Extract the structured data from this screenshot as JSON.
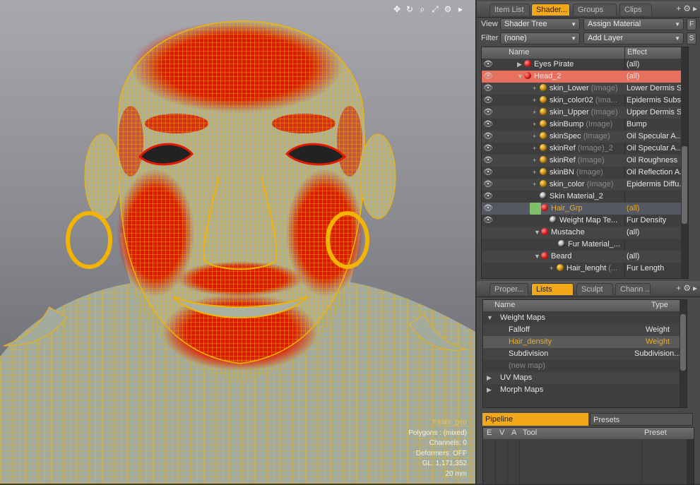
{
  "viewport": {
    "toolbar_icons": [
      "move-icon",
      "rotate-icon",
      "zoom-icon",
      "fit-icon",
      "settings-icon",
      "expand-icon"
    ],
    "info": {
      "mesh": "Pirate_geo",
      "polygons": "Polygons : (mixed)",
      "channels": "Channels: 0",
      "deformers": "Deformers: OFF",
      "gl": "GL: 1,171,352",
      "units": "20 mm"
    }
  },
  "top_tabs": [
    "Item List",
    "Shader...",
    "Groups",
    "Clips"
  ],
  "top_tabs_active": 1,
  "shader_controls": {
    "view_label": "View",
    "view_value": "Shader Tree",
    "assign_material": "Assign Material",
    "filter_label": "Filter",
    "filter_value": "(none)",
    "add_layer": "Add Layer",
    "f_button": "F",
    "s_button": "S"
  },
  "shader_tree": {
    "col_name": "Name",
    "col_effect": "Effect",
    "rows": [
      {
        "name": "Eyes Pirate",
        "sub": "",
        "effect": "(all)"
      },
      {
        "name": "Head_2",
        "sub": "",
        "effect": "(all)"
      },
      {
        "name": "skin_Lower",
        "sub": "(Image)",
        "effect": "Lower Dermis S..."
      },
      {
        "name": "skin_color02",
        "sub": "(Ima...",
        "effect": "Epidermis Subs..."
      },
      {
        "name": "skin_Upper",
        "sub": "(Image)",
        "effect": "Upper Dermis S..."
      },
      {
        "name": "skinBump",
        "sub": "(Image)",
        "effect": "Bump"
      },
      {
        "name": "skinSpec",
        "sub": "(Image)",
        "effect": "Oil Specular A..."
      },
      {
        "name": "skinRef",
        "sub": "(Image)_2",
        "effect": "Oil Specular A..."
      },
      {
        "name": "skinRef",
        "sub": "(Image)",
        "effect": "Oil Roughness"
      },
      {
        "name": "skinBN",
        "sub": "(Image)",
        "effect": "Oil Reflection A..."
      },
      {
        "name": "skin_color",
        "sub": "(Image)",
        "effect": "Epidermis Diffu..."
      },
      {
        "name": "Skin Material_2",
        "sub": "",
        "effect": ""
      },
      {
        "name": "Hair_Grp",
        "sub": "",
        "effect": "(all)"
      },
      {
        "name": "Weight Map Te...",
        "sub": "",
        "effect": "Fur Density"
      },
      {
        "name": "Mustache",
        "sub": "",
        "effect": "(all)"
      },
      {
        "name": "Fur Material_...",
        "sub": "",
        "effect": ""
      },
      {
        "name": "Beard",
        "sub": "",
        "effect": "(all)"
      },
      {
        "name": "Hair_lenght",
        "sub": "(...",
        "effect": "Fur Length"
      }
    ]
  },
  "bottom_tabs": [
    "Proper...",
    "Lists",
    "Sculpt",
    "Chann ..."
  ],
  "bottom_tabs_active": 1,
  "lists": {
    "col_name": "Name",
    "col_type": "Type",
    "rows": [
      {
        "name": "Weight Maps",
        "type": ""
      },
      {
        "name": "Falloff",
        "type": "Weight"
      },
      {
        "name": "Hair_density",
        "type": "Weight"
      },
      {
        "name": "Subdivision",
        "type": "Subdivision..."
      },
      {
        "name": "(new map)",
        "type": ""
      },
      {
        "name": "UV Maps",
        "type": ""
      },
      {
        "name": "Morph Maps",
        "type": ""
      }
    ]
  },
  "pipeline": {
    "tab_pipeline": "Pipeline",
    "tab_presets": "Presets",
    "cols": [
      "E",
      "V",
      "A",
      "Tool",
      "Preset"
    ]
  },
  "colors": {
    "accent": "#f2a818",
    "selection": "#e8705e",
    "wire": "#f2b400",
    "weight": "#e01a00"
  }
}
